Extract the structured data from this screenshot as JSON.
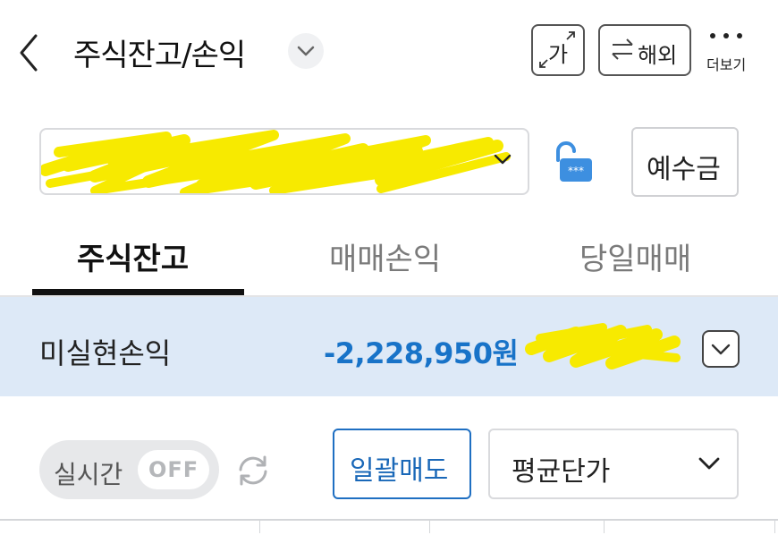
{
  "header": {
    "title": "주식잔고/손익",
    "font_size_button": "가",
    "overseas_button": "해외",
    "more_label": "더보기"
  },
  "account": {
    "number_redacted": true,
    "deposit_button": "예수금"
  },
  "tabs": [
    {
      "label": "주식잔고",
      "active": true
    },
    {
      "label": "매매손익",
      "active": false
    },
    {
      "label": "당일매매",
      "active": false
    }
  ],
  "profit": {
    "label": "미실현손익",
    "value": "-2,228,950원"
  },
  "controls": {
    "realtime_label": "실시간",
    "realtime_state": "OFF",
    "bulk_sell_button": "일괄매도",
    "price_select_value": "평균단가"
  },
  "colors": {
    "accent_blue": "#1873c8",
    "highlight_row": "#dde9f7",
    "lock_icon": "#3d8fe0",
    "redaction": "#f7ea00"
  },
  "icons": [
    "back-icon",
    "chevron-down-icon",
    "resize-icon",
    "swap-icon",
    "more-dots-icon",
    "lock-icon",
    "refresh-icon"
  ]
}
